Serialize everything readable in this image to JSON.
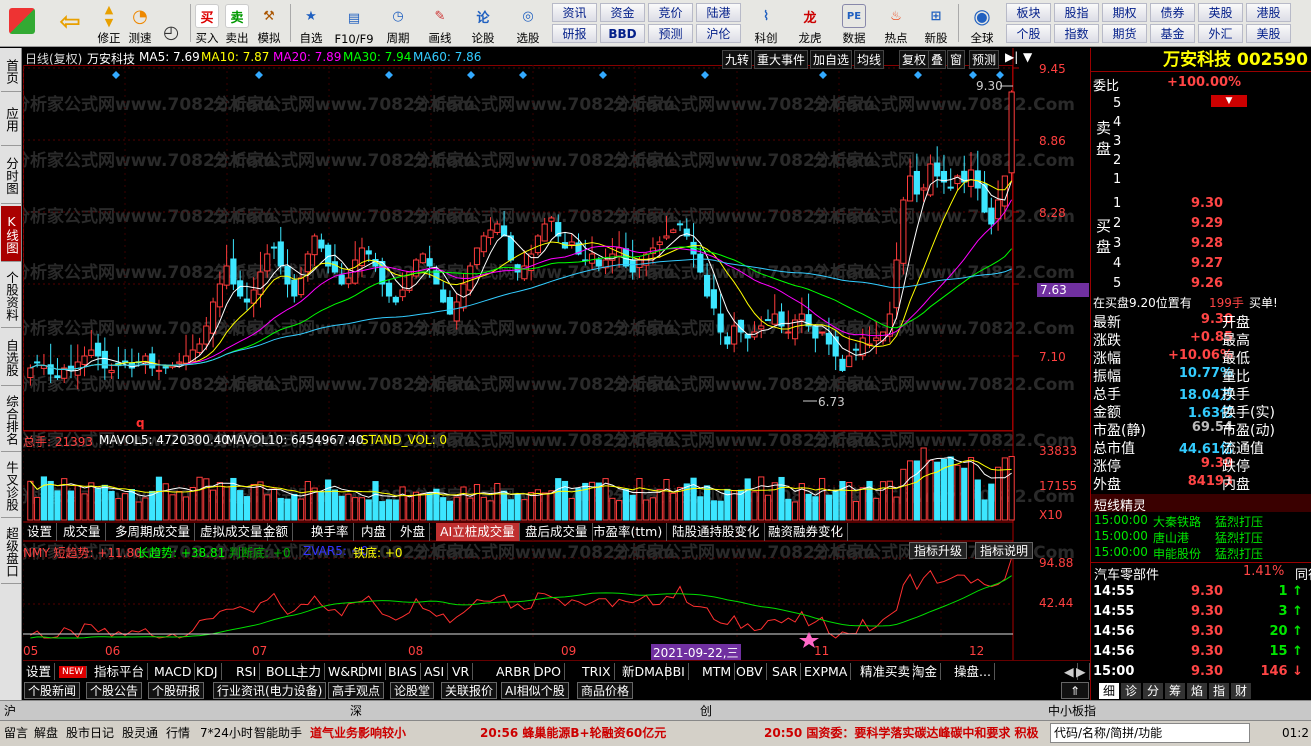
{
  "toolbar": {
    "left": [
      "修正",
      "测速",
      "买入",
      "卖出",
      "模拟",
      "自选",
      "F10/F9",
      "周期",
      "画线",
      "论股",
      "选股"
    ],
    "row1": [
      "资讯",
      "资金",
      "竞价",
      "陆港"
    ],
    "row2": [
      "研报",
      "BBD",
      "预测",
      "沪伦"
    ],
    "tools": [
      "科创",
      "龙虎",
      "数据",
      "热点",
      "新股"
    ],
    "global": "全球",
    "r1": [
      "板块",
      "股指",
      "期权",
      "债券",
      "英股",
      "港股"
    ],
    "r2": [
      "个股",
      "指数",
      "期货",
      "基金",
      "外汇",
      "美股"
    ]
  },
  "leftnav": [
    "首页",
    "应用",
    "分时图",
    "K线图",
    "个股资料",
    "自选股",
    "综合排名",
    "牛叉诊股",
    "超级盘口"
  ],
  "chart": {
    "header": {
      "label": "日线(复权)",
      "name": "万安科技",
      "ma5": "MA5: 7.69",
      "ma10": "MA10: 7.87",
      "ma20": "MA20: 7.89",
      "ma30": "MA30: 7.94",
      "ma60": "MA60: 7.86"
    },
    "top_buttons": [
      "九转",
      "重大事件",
      "加自选",
      "均线",
      "复权",
      "叠",
      "窗",
      "预测"
    ],
    "price_ticks": [
      "9.45",
      "8.86",
      "8.28",
      "7.63",
      "7.10"
    ],
    "current_price": "7.63",
    "high_label": "9.30",
    "low_label": "6.73",
    "volume_header": {
      "a": "总手: 21393",
      "b": "MAVOL5: 4720300.40",
      "c": "MAVOL10: 6454967.40",
      "d": "STAND_VOL: 0"
    },
    "volume_ticks": [
      "33833",
      "17155",
      "X10"
    ],
    "tabs": [
      "设置",
      "成交量",
      "多周期成交量",
      "虚拟成交量",
      "金额",
      "换手率",
      "内盘",
      "外盘",
      "AI立桩成交量",
      "盘后成交量",
      "市盈率(ttm)",
      "陆股通持股变化",
      "融资融券变化"
    ],
    "ind_header": {
      "a": "NMY 短趋势: +11.80",
      "b": "长趋势: +38.81",
      "c": "判断底: +0",
      "d": "ZVAR5: +0",
      "e": "铁底: +0"
    },
    "ind_buttons": [
      "指标升级",
      "指标说明"
    ],
    "ind_ticks": [
      "94.88",
      "42.44"
    ],
    "months": [
      "05",
      "06",
      "07",
      "08",
      "09",
      "10",
      "11",
      "12"
    ],
    "date_badge": "2021-09-22,三",
    "watermark": "分析家公式网www.70822.Com",
    "q_mark": "q"
  },
  "chart_data": {
    "type": "candlestick",
    "ylim": [
      6.5,
      9.5
    ],
    "closes": [
      7.0,
      7.05,
      7.02,
      6.95,
      6.92,
      7.0,
      6.98,
      7.05,
      7.1,
      7.15,
      7.1,
      7.0,
      6.98,
      7.02,
      7.05,
      7.0,
      7.05,
      7.1,
      7.0,
      6.98,
      7.0,
      7.02,
      7.05,
      7.1,
      7.15,
      7.2,
      7.35,
      7.55,
      7.7,
      7.85,
      7.7,
      7.6,
      7.55,
      7.65,
      7.8,
      7.95,
      8.0,
      7.85,
      7.7,
      7.6,
      7.75,
      7.95,
      8.1,
      8.0,
      7.85,
      7.8,
      7.7,
      7.75,
      7.9,
      8.0,
      7.95,
      7.85,
      7.7,
      7.6,
      7.55,
      7.65,
      7.8,
      7.9,
      7.95,
      7.85,
      7.7,
      7.55,
      7.45,
      7.55,
      7.7,
      7.85,
      8.0,
      8.1,
      8.15,
      8.2,
      8.1,
      7.9,
      7.8,
      7.85,
      7.95,
      8.1,
      8.2,
      8.25,
      8.1,
      8.0,
      8.05,
      7.95,
      7.9,
      7.95,
      7.85,
      7.9,
      7.95,
      8.0,
      7.85,
      7.8,
      7.9,
      7.95,
      8.0,
      8.05,
      8.1,
      8.15,
      8.2,
      8.1,
      7.95,
      7.8,
      7.6,
      7.5,
      7.3,
      7.2,
      7.35,
      7.3,
      7.25,
      7.3,
      7.35,
      7.4,
      7.45,
      7.35,
      7.3,
      7.4,
      7.45,
      7.35,
      7.25,
      7.3,
      7.2,
      7.1,
      6.98,
      7.1,
      7.15,
      7.25,
      7.2,
      7.25,
      7.3,
      7.45,
      7.9,
      8.4,
      8.6,
      8.45,
      8.5,
      8.7,
      8.6,
      8.55,
      8.5,
      8.6,
      8.55,
      8.65,
      8.5,
      8.3,
      8.2,
      8.4,
      8.6,
      9.3
    ],
    "volume_scale": [
      0,
      33833
    ],
    "indicator_scale": [
      0,
      100
    ],
    "series": [
      {
        "name": "短趋势",
        "color": "#ff3030"
      },
      {
        "name": "长趋势",
        "color": "#00dd00"
      }
    ]
  },
  "bottom_tabs": [
    "设置",
    "NEW",
    "指标平台",
    "MACD",
    "KDJ",
    "RSI",
    "BOLL",
    "主力",
    "W&R",
    "DMI",
    "BIAS",
    "ASI",
    "VR",
    "ARBR",
    "DPO",
    "TRIX",
    "新DMA",
    "BBI",
    "MTM",
    "OBV",
    "SAR",
    "EXPMA",
    "精准买卖",
    "淘金",
    "操盘..."
  ],
  "bottom_tabs2": [
    "个股新闻",
    "个股公告",
    "个股研报",
    "行业资讯(电力设备)",
    "高手观点",
    "论股堂",
    "关联报价",
    "AI相似个股",
    "商品价格"
  ],
  "rp": {
    "title": "万安科技 002590",
    "weibi_label": "委比",
    "weibi": "+100.00%",
    "sell_label": "卖盘",
    "buy_label": "买盘",
    "sell_levels": [
      "5",
      "4",
      "3",
      "2",
      "1"
    ],
    "buy": [
      {
        "l": "1",
        "p": "9.30"
      },
      {
        "l": "2",
        "p": "9.29"
      },
      {
        "l": "3",
        "p": "9.28"
      },
      {
        "l": "4",
        "p": "9.27"
      },
      {
        "l": "5",
        "p": "9.26"
      }
    ],
    "bid_info": "在买盘9.20位置有",
    "bid_qty": "199手",
    "bid_tag": "买单!",
    "stats": [
      {
        "k": "最新",
        "v": "9.30",
        "k2": "开盘",
        "c": "red"
      },
      {
        "k": "涨跌",
        "v": "+0.85",
        "k2": "最高",
        "c": "red"
      },
      {
        "k": "涨幅",
        "v": "+10.06%",
        "k2": "最低",
        "c": "red"
      },
      {
        "k": "振幅",
        "v": "10.77%",
        "k2": "量比",
        "c": "cyn"
      },
      {
        "k": "总手",
        "v": "18.04万",
        "k2": "换手",
        "c": "cyn"
      },
      {
        "k": "金额",
        "v": "1.63亿",
        "k2": "换手(实)",
        "c": "cyn"
      },
      {
        "k": "市盈(静)",
        "v": "69.54",
        "k2": "市盈(动)",
        "c": "gry"
      },
      {
        "k": "总市值",
        "v": "44.61亿",
        "k2": "流通值",
        "c": "cyn"
      },
      {
        "k": "涨停",
        "v": "9.30",
        "k2": "跌停",
        "c": "red"
      },
      {
        "k": "外盘",
        "v": "84193",
        "k2": "内盘",
        "c": "red"
      }
    ],
    "sprite_label": "短线精灵",
    "sprites": [
      {
        "t": "15:00:00",
        "n": "大秦铁路",
        "e": "猛烈打压"
      },
      {
        "t": "15:00:00",
        "n": "唐山港",
        "e": "猛烈打压"
      },
      {
        "t": "15:00:00",
        "n": "申能股份",
        "e": "猛烈打压"
      }
    ],
    "sector": "汽车零部件",
    "sector_pct": "1.41%",
    "peer": "同行",
    "ticks": [
      {
        "t": "14:55",
        "p": "9.30",
        "v": "1"
      },
      {
        "t": "14:55",
        "p": "9.30",
        "v": "3"
      },
      {
        "t": "14:56",
        "p": "9.30",
        "v": "20"
      },
      {
        "t": "14:56",
        "p": "9.30",
        "v": "15"
      },
      {
        "t": "15:00",
        "p": "9.30",
        "v": "146"
      }
    ],
    "tabs": [
      "细",
      "诊",
      "分",
      "筹",
      "焰",
      "指",
      "财"
    ]
  },
  "index_bar": {
    "a": "沪",
    "b": "深",
    "c": "创",
    "d": "中小板指"
  },
  "status": {
    "items": [
      "留言",
      "解盘",
      "股市日记",
      "股灵通",
      "行情",
      "7*24小时",
      "智能助手"
    ],
    "ticker1": "道气业务影响较小",
    "ticker2": "20:56 蜂巢能源B+轮融资60亿元",
    "ticker3": "20:50 国资委：要科学落实碳达峰碳中和要求 积极",
    "search": "代码/名称/简拼/功能",
    "time": "01:2"
  }
}
